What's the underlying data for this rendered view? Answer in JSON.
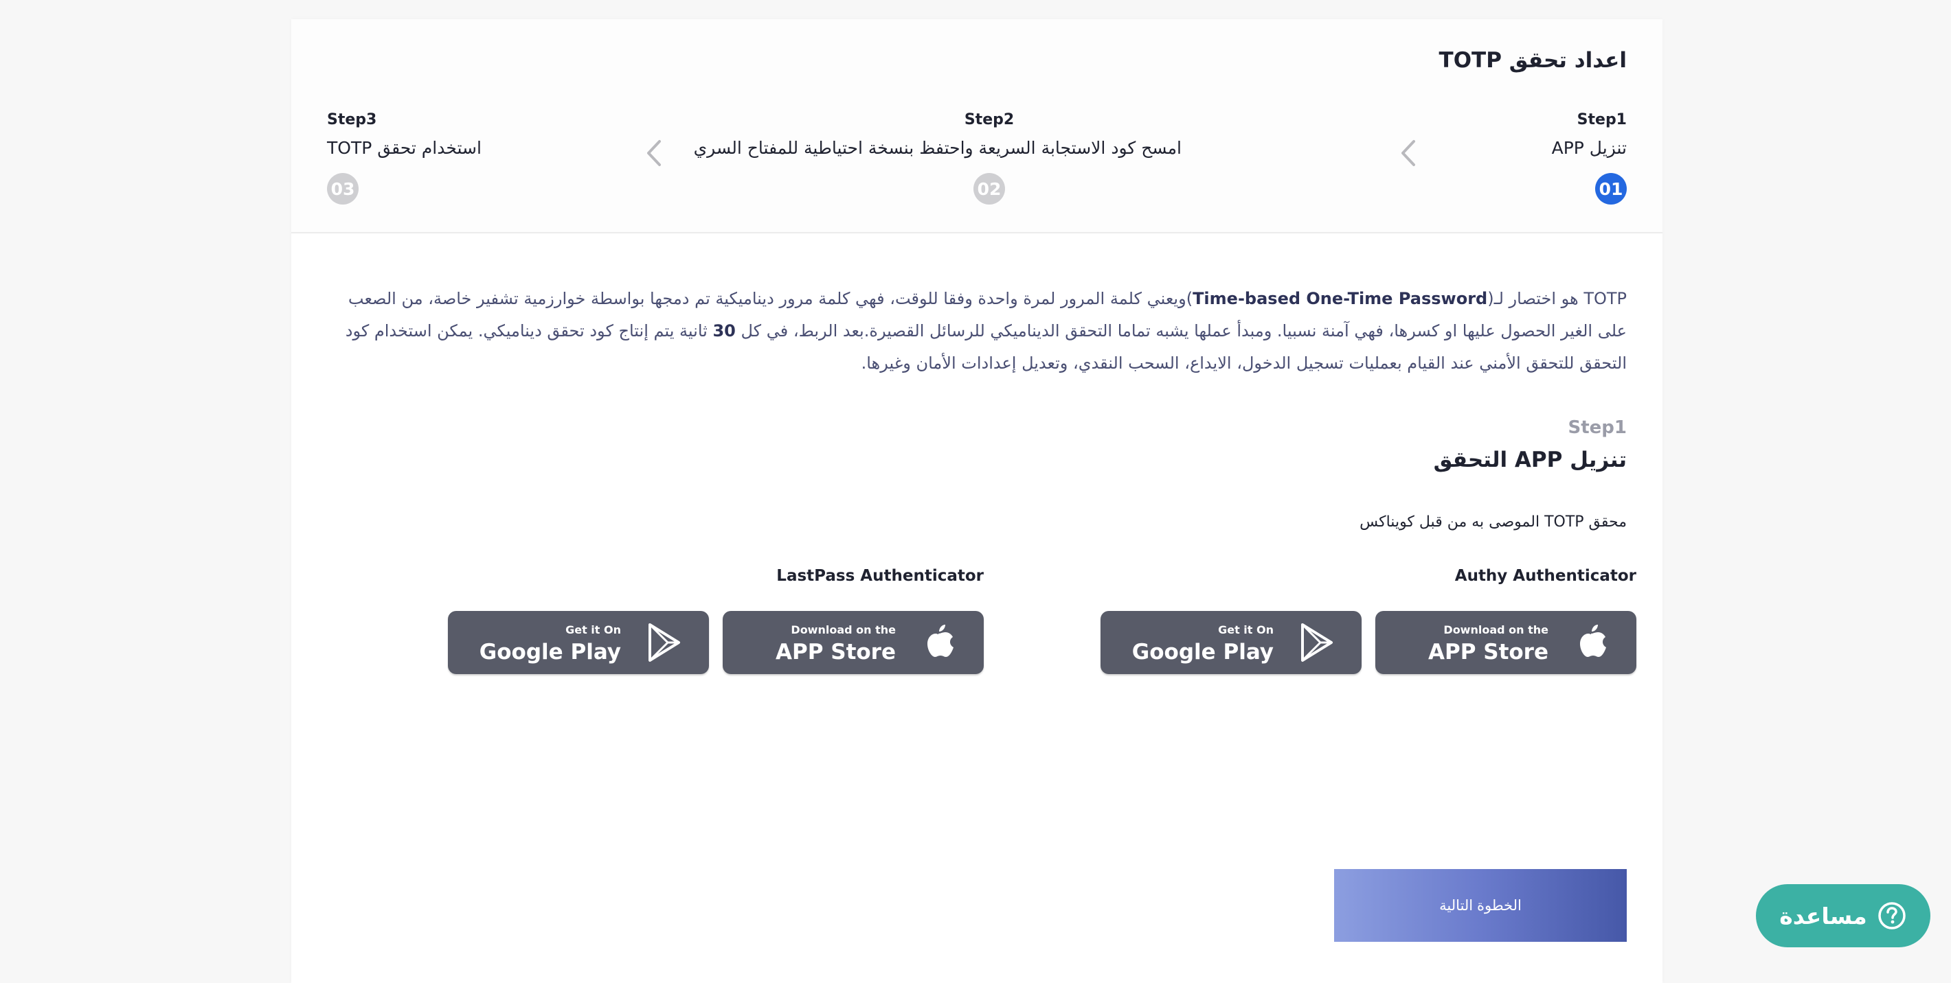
{
  "page": {
    "title": "اعداد تحقق TOTP"
  },
  "steps": [
    {
      "num": "Step1",
      "label": "تنزيل APP",
      "badge": "01",
      "active": true
    },
    {
      "num": "Step2",
      "label": "امسح كود الاستجابة السريعة واحتفظ بنسخة احتياطية للمفتاح السري",
      "badge": "02",
      "active": false
    },
    {
      "num": "Step3",
      "label": "استخدام تحقق TOTP",
      "badge": "03",
      "active": false
    }
  ],
  "intro": {
    "prefix": "TOTP هو اختصار لـ(",
    "term": "Time-based One-Time Password",
    "rest1": ")ويعني كلمة المرور لمرة واحدة وفقا للوقت، فهي كلمة مرور ديناميكية تم دمجها بواسطة خوارزمية تشفير خاصة، من الصعب على الغير الحصول عليها او كسرها، فهي آمنة نسبيا. ومبدأ عملها يشبه تماما التحقق الديناميكي للرسائل القصيرة.بعد الربط، في كل ",
    "seconds": "30",
    "rest2": " ثانية يتم إنتاج كود تحقق ديناميكي. يمكن استخدام كود التحقق للتحقق الأمني عند القيام بعمليات تسجيل الدخول، الايداع، السحب النقدي، وتعديل إعدادات الأمان وغيرها."
  },
  "section": {
    "step_num": "Step1",
    "title": "تنزيل APP التحقق",
    "recommend": "محقق TOTP الموصى به من قبل كويناكس"
  },
  "apps": [
    {
      "name": "Authy Authenticator",
      "apple": {
        "small": "Download on the",
        "big": "APP Store",
        "icon": "apple-icon"
      },
      "google": {
        "small": "Get it On",
        "big": "Google Play",
        "icon": "play-icon"
      }
    },
    {
      "name": "LastPass Authenticator",
      "apple": {
        "small": "Download on the",
        "big": "APP Store",
        "icon": "apple-icon"
      },
      "google": {
        "small": "Get it On",
        "big": "Google Play",
        "icon": "play-icon"
      }
    }
  ],
  "actions": {
    "next": "الخطوة التالية",
    "help": "مساعدة",
    "help_icon": "question-icon"
  },
  "colors": {
    "accent": "#2468e0",
    "store_button": "#585b68",
    "help": "#3cb1a4",
    "next_gradient_start": "#8c9ee0",
    "next_gradient_end": "#4658a8"
  }
}
